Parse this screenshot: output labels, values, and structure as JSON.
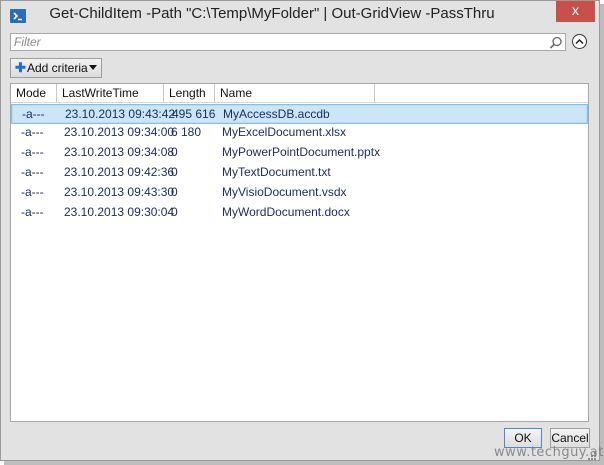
{
  "window": {
    "title": "Get-ChildItem -Path \"C:\\Temp\\MyFolder\" | Out-GridView -PassThru",
    "close_label": "x"
  },
  "filter": {
    "placeholder": "Filter",
    "value": ""
  },
  "toolbar": {
    "add_criteria_label": "Add criteria"
  },
  "grid": {
    "columns": [
      "Mode",
      "LastWriteTime",
      "Length",
      "Name"
    ],
    "rows": [
      {
        "mode": "-a---",
        "time": "23.10.2013 09:43:42",
        "length": "495 616",
        "name": "MyAccessDB.accdb",
        "selected": true
      },
      {
        "mode": "-a---",
        "time": "23.10.2013 09:34:00",
        "length": "6 180",
        "name": "MyExcelDocument.xlsx",
        "selected": false
      },
      {
        "mode": "-a---",
        "time": "23.10.2013 09:34:08",
        "length": "0",
        "name": "MyPowerPointDocument.pptx",
        "selected": false
      },
      {
        "mode": "-a---",
        "time": "23.10.2013 09:42:36",
        "length": "0",
        "name": "MyTextDocument.txt",
        "selected": false
      },
      {
        "mode": "-a---",
        "time": "23.10.2013 09:43:30",
        "length": "0",
        "name": "MyVisioDocument.vsdx",
        "selected": false
      },
      {
        "mode": "-a---",
        "time": "23.10.2013 09:30:04",
        "length": "0",
        "name": "MyWordDocument.docx",
        "selected": false
      }
    ]
  },
  "buttons": {
    "ok_label": "OK",
    "cancel_label": "Cancel"
  },
  "watermark": "www.techguy.at",
  "colors": {
    "close_button": "#c7504b",
    "selection": "#cce6f7",
    "row_text": "#1a2b5c"
  }
}
